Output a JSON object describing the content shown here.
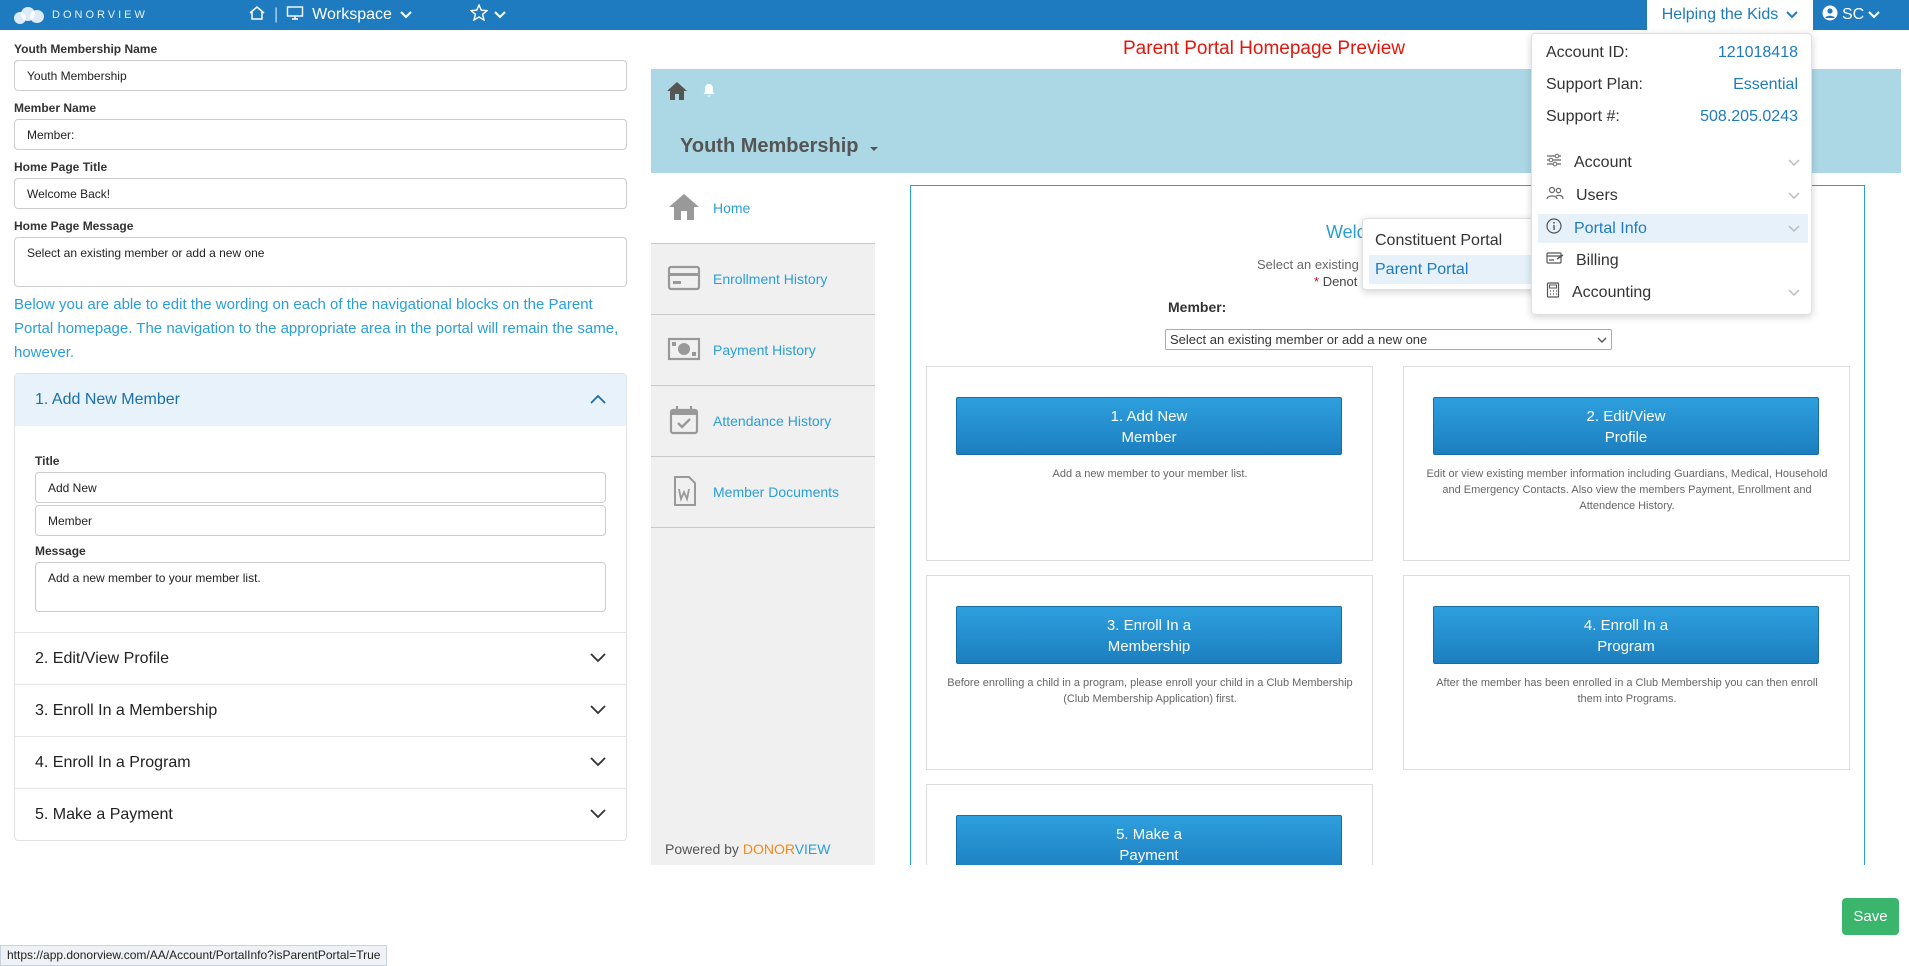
{
  "topbar": {
    "logo_text": "DONORVIEW",
    "workspace_label": "Workspace",
    "org_label": "Helping the Kids",
    "user_initials": "SC"
  },
  "form": {
    "youth_membership_name_label": "Youth Membership Name",
    "youth_membership_name_value": "Youth Membership",
    "member_name_label": "Member Name",
    "member_name_value": "Member:",
    "home_title_label": "Home Page Title",
    "home_title_value": "Welcome Back!",
    "home_message_label": "Home Page Message",
    "home_message_value": "Select an existing member or add a new one",
    "info_text": "Below you are able to edit the wording on each of the navigational blocks on the Parent Portal homepage. The navigation to the appropriate area in the portal will remain the same, however."
  },
  "accordion": {
    "open_section": {
      "header": "1. Add New Member",
      "title_label": "Title",
      "title_line1": "Add New",
      "title_line2": "Member",
      "message_label": "Message",
      "message_value": "Add a new member to your member list."
    },
    "closed_sections": [
      "2. Edit/View Profile",
      "3. Enroll In a Membership",
      "4. Enroll In a Program",
      "5. Make a Payment"
    ]
  },
  "preview": {
    "title": "Parent Portal Homepage Preview",
    "org_name": "Youth Membership",
    "nav": [
      "Home",
      "Enrollment History",
      "Payment History",
      "Attendance History",
      "Member Documents"
    ],
    "powered_by": "Powered by",
    "powered_d1": "DONOR",
    "powered_d2": "VIEW",
    "welcome": "Welco",
    "select_hint": "Select an existing",
    "denote_text": "Denot",
    "member_label": "Member:",
    "member_select": "Select an existing member or add a new one",
    "cards": [
      {
        "button": "1. Add New\nMember",
        "desc": "Add a new member to your member list."
      },
      {
        "button": "2. Edit/View\nProfile",
        "desc": "Edit or view existing member information including Guardians, Medical, Household and Emergency Contacts. Also view the members Payment, Enrollment and Attendence History."
      },
      {
        "button": "3. Enroll In a\nMembership",
        "desc": "Before enrolling a child in a program, please enroll your child in a Club Membership (Club Membership Application) first."
      },
      {
        "button": "4. Enroll In a\nProgram",
        "desc": "After the member has been enrolled in a Club Membership you can then enroll them into Programs."
      },
      {
        "button": "5. Make a\nPayment",
        "desc": ""
      }
    ]
  },
  "account_menu": {
    "account_id_label": "Account ID:",
    "account_id_value": "121018418",
    "support_plan_label": "Support Plan:",
    "support_plan_value": "Essential",
    "support_num_label": "Support #:",
    "support_num_value": "508.205.0243",
    "items": [
      "Account",
      "Users",
      "Portal Info",
      "Billing",
      "Accounting"
    ],
    "submenu": [
      "Constituent Portal",
      "Parent Portal"
    ]
  },
  "save_label": "Save",
  "status_url": "https://app.donorview.com/AA/Account/PortalInfo?isParentPortal=True",
  "colors": {
    "topbar": "#1e7bbf",
    "accent": "#2a9fd6",
    "save": "#3bb56b",
    "preview_title": "#e3160c"
  }
}
